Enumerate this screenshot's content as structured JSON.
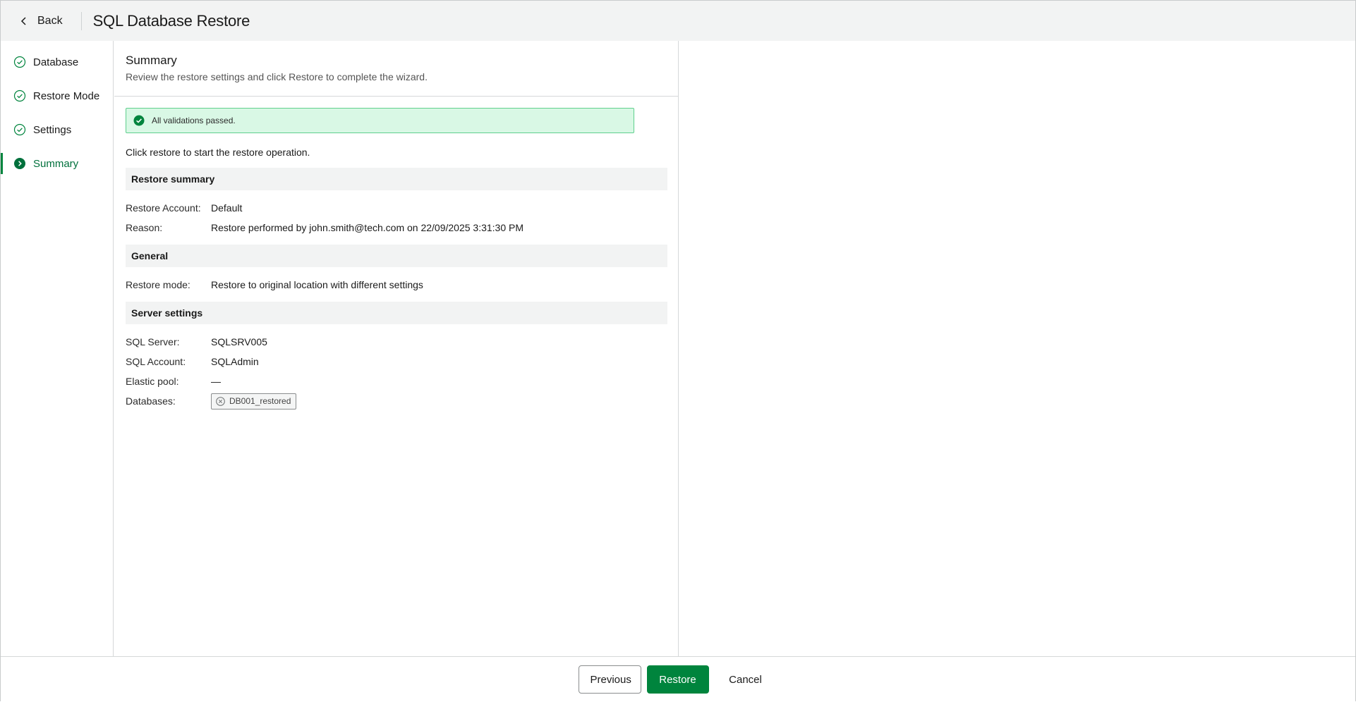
{
  "header": {
    "back_label": "Back",
    "title": "SQL Database Restore"
  },
  "sidebar": {
    "steps": [
      {
        "label": "Database",
        "state": "completed",
        "icon": "check-circle-icon"
      },
      {
        "label": "Restore Mode",
        "state": "completed",
        "icon": "check-circle-icon"
      },
      {
        "label": "Settings",
        "state": "completed",
        "icon": "check-circle-icon"
      },
      {
        "label": "Summary",
        "state": "active",
        "icon": "chevron-right-circle-icon"
      }
    ]
  },
  "main": {
    "title": "Summary",
    "subtitle": "Review the restore settings and click Restore to complete the wizard.",
    "alert": "All validations passed.",
    "intro": "Click restore to start the restore operation.",
    "restore_summary": {
      "heading": "Restore summary",
      "rows": [
        {
          "label": "Restore Account:",
          "value": "Default"
        },
        {
          "label": "Reason:",
          "value": "Restore performed by john.smith@tech.com on 22/09/2025 3:31:30 PM"
        }
      ]
    },
    "general": {
      "heading": "General",
      "rows": [
        {
          "label": "Restore mode:",
          "value": "Restore to original location with different settings"
        }
      ]
    },
    "server_settings": {
      "heading": "Server settings",
      "rows": [
        {
          "label": "SQL Server:",
          "value": "SQLSRV005"
        },
        {
          "label": "SQL Account:",
          "value": "SQLAdmin"
        },
        {
          "label": "Elastic pool:",
          "value": "—"
        }
      ],
      "databases_label": "Databases:",
      "databases": [
        "DB001_restored"
      ]
    }
  },
  "footer": {
    "previous_label": "Previous",
    "restore_label": "Restore",
    "cancel_label": "Cancel"
  },
  "colors": {
    "accent": "#00843d",
    "alert_bg": "#d9f8e5",
    "alert_border": "#5fcf8d",
    "header_bg": "#f2f3f3"
  }
}
